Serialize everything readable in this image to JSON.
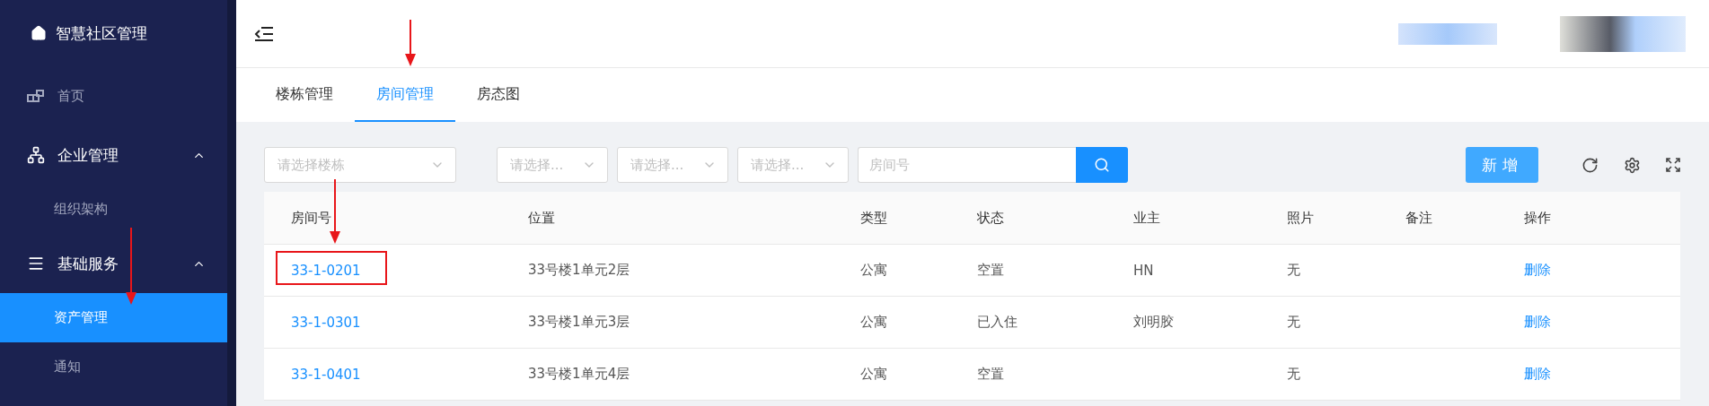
{
  "sidebar": {
    "title": "智慧社区管理",
    "items": [
      {
        "label": "首页",
        "kind": "link",
        "selected": false
      },
      {
        "label": "企业管理",
        "kind": "group",
        "expanded": true,
        "children": [
          {
            "label": "组织架构",
            "selected": false
          }
        ]
      },
      {
        "label": "基础服务",
        "kind": "group",
        "expanded": true,
        "children": [
          {
            "label": "资产管理",
            "selected": true
          },
          {
            "label": "通知",
            "selected": false
          }
        ]
      }
    ]
  },
  "tabs": [
    {
      "label": "楼栋管理",
      "selected": false
    },
    {
      "label": "房间管理",
      "selected": true
    },
    {
      "label": "房态图",
      "selected": false
    }
  ],
  "filters": [
    {
      "kind": "select",
      "placeholder": "请选择楼栋"
    },
    {
      "kind": "select",
      "placeholder": "请选择..."
    },
    {
      "kind": "select",
      "placeholder": "请选择..."
    },
    {
      "kind": "select",
      "placeholder": "请选择..."
    },
    {
      "kind": "input",
      "placeholder": "房间号"
    }
  ],
  "add_button": "新增",
  "table": {
    "columns": [
      {
        "label": "房间号",
        "kind": "link"
      },
      {
        "label": "位置",
        "kind": "text"
      },
      {
        "label": "类型",
        "kind": "text"
      },
      {
        "label": "状态",
        "kind": "text"
      },
      {
        "label": "业主",
        "kind": "text"
      },
      {
        "label": "照片",
        "kind": "text"
      },
      {
        "label": "备注",
        "kind": "text"
      },
      {
        "label": "操作",
        "kind": "link"
      }
    ],
    "rows": [
      [
        "33-1-0201",
        "33号楼1单元2层",
        "公寓",
        "空置",
        "HN",
        "无",
        "",
        "删除"
      ],
      [
        "33-1-0301",
        "33号楼1单元3层",
        "公寓",
        "已入住",
        "刘明胶",
        "无",
        "",
        "删除"
      ],
      [
        "33-1-0401",
        "33号楼1单元4层",
        "公寓",
        "空置",
        "",
        "无",
        "",
        "删除"
      ]
    ]
  }
}
